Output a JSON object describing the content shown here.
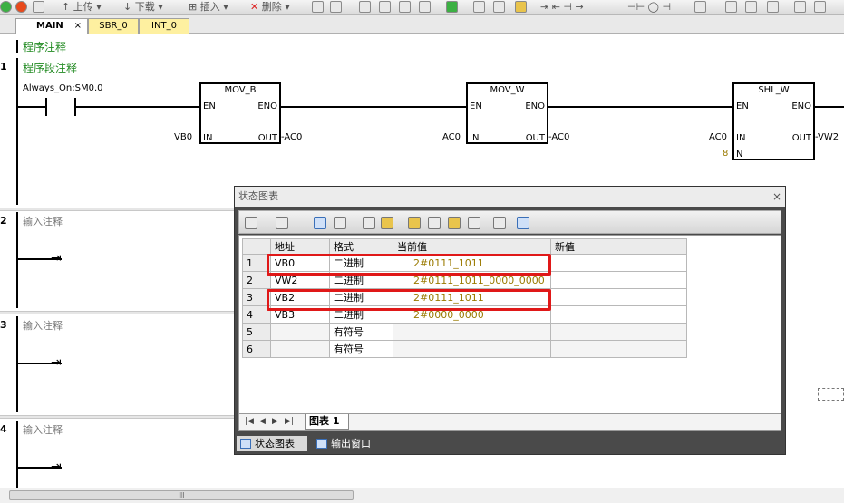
{
  "toolbar": {
    "upload": "上传",
    "download": "下载",
    "insert": "插入",
    "delete": "删除"
  },
  "tabs": [
    {
      "label": "MAIN"
    },
    {
      "label": "SBR_0"
    },
    {
      "label": "INT_0"
    }
  ],
  "tab_close": "×",
  "program_comment": "程序注释",
  "networks": [
    {
      "number": "1",
      "comment": "程序段注释"
    },
    {
      "number": "2",
      "comment": "输入注释"
    },
    {
      "number": "3",
      "comment": "输入注释"
    },
    {
      "number": "4",
      "comment": "输入注释"
    }
  ],
  "ladder": {
    "contact_label": "Always_On:SM0.0",
    "blocks": [
      {
        "name": "MOV_B",
        "en": "EN",
        "eno": "ENO",
        "in": "IN",
        "out": "OUT",
        "in_var": "VB0",
        "out_var": "AC0"
      },
      {
        "name": "MOV_W",
        "en": "EN",
        "eno": "ENO",
        "in": "IN",
        "out": "OUT",
        "in_var": "AC0",
        "out_var": "AC0"
      },
      {
        "name": "SHL_W",
        "en": "EN",
        "eno": "ENO",
        "in": "IN",
        "n": "N",
        "out": "OUT",
        "in_var": "AC0",
        "n_var": "8",
        "out_var": "VW2"
      }
    ]
  },
  "status_chart": {
    "title": "状态图表",
    "close": "×",
    "columns": [
      "地址",
      "格式",
      "当前值",
      "新值"
    ],
    "rows": [
      {
        "n": "1",
        "addr": "VB0",
        "fmt": "二进制",
        "cur": "2#0111_1011",
        "new": ""
      },
      {
        "n": "2",
        "addr": "VW2",
        "fmt": "二进制",
        "cur": "2#0111_1011_0000_0000",
        "new": ""
      },
      {
        "n": "3",
        "addr": "VB2",
        "fmt": "二进制",
        "cur": "2#0111_1011",
        "new": ""
      },
      {
        "n": "4",
        "addr": "VB3",
        "fmt": "二进制",
        "cur": "2#0000_0000",
        "new": ""
      },
      {
        "n": "5",
        "addr": "",
        "fmt": "有符号",
        "cur": "",
        "new": ""
      },
      {
        "n": "6",
        "addr": "",
        "fmt": "有符号",
        "cur": "",
        "new": ""
      }
    ],
    "sheet_tab": "图表 1",
    "bottom_tabs": [
      "状态图表",
      "输出窗口"
    ],
    "highlight_color": "#e01818"
  },
  "scroll_thumb": "III",
  "colors": {
    "comment_green": "#228b22",
    "tab_yellow": "#fef0a0",
    "value_olive": "#9a7a00"
  }
}
